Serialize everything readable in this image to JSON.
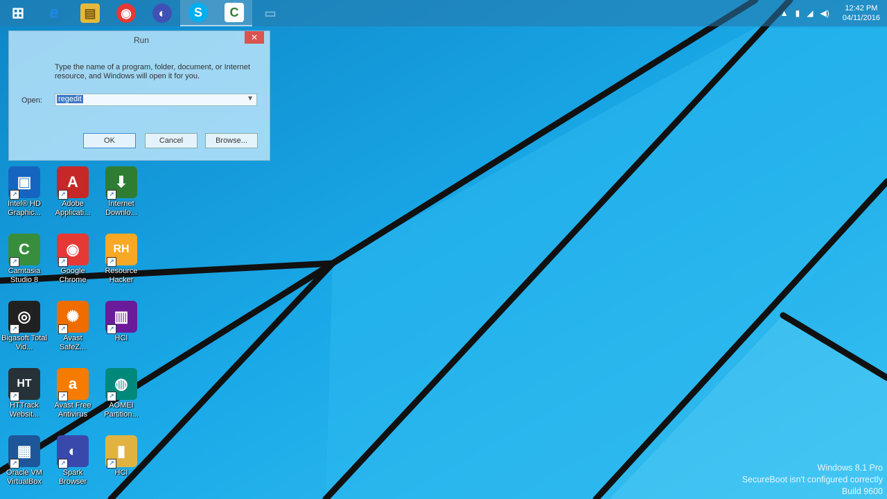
{
  "taskbar": {
    "apps": [
      {
        "name": "start-button",
        "glyph": "⊞",
        "color": "transparent"
      },
      {
        "name": "internet-explorer-icon",
        "glyph": "e",
        "color": "#1e88e5"
      },
      {
        "name": "file-explorer-icon",
        "glyph": "▤",
        "color": "#e6b93b"
      },
      {
        "name": "google-chrome-icon",
        "glyph": "◉",
        "color": "#e53935"
      },
      {
        "name": "spark-browser-icon",
        "glyph": "◐",
        "color": "#3f51b5"
      },
      {
        "name": "skype-icon",
        "glyph": "S",
        "color": "#00aff0"
      },
      {
        "name": "camtasia-icon",
        "glyph": "C",
        "color": "#2e7d32"
      },
      {
        "name": "window-icon",
        "glyph": "▭",
        "color": "transparent"
      }
    ],
    "clock_time": "12:42 PM",
    "clock_date": "04/11/2016"
  },
  "run_dialog": {
    "title": "Run",
    "description": "Type the name of a program, folder, document, or Internet resource, and Windows will open it for you.",
    "open_label": "Open:",
    "input_value": "regedit",
    "ok_label": "OK",
    "cancel_label": "Cancel",
    "browse_label": "Browse..."
  },
  "desktop_icons": [
    {
      "label": "Intel® HD Graphic...",
      "glyph": "▣",
      "color": "#1565c0"
    },
    {
      "label": "Adobe Applicati...",
      "glyph": "A",
      "color": "#c62828"
    },
    {
      "label": "Internet Downlo...",
      "glyph": "⬇",
      "color": "#2e7d32"
    },
    {
      "label": "Camtasia Studio 8",
      "glyph": "C",
      "color": "#388e3c"
    },
    {
      "label": "Google Chrome",
      "glyph": "◉",
      "color": "#e53935"
    },
    {
      "label": "Resource Hacker",
      "glyph": "RH",
      "color": "#f9a825"
    },
    {
      "label": "Bigasoft Total Vid...",
      "glyph": "◎",
      "color": "#212121"
    },
    {
      "label": "Avast SafeZ...",
      "glyph": "✺",
      "color": "#ef6c00"
    },
    {
      "label": "HCI",
      "glyph": "▥",
      "color": "#6a1b9a"
    },
    {
      "label": "HTTrack Websit...",
      "glyph": "HT",
      "color": "#263238"
    },
    {
      "label": "Avast Free Antivirus",
      "glyph": "a",
      "color": "#f57c00"
    },
    {
      "label": "AOMEI Partition...",
      "glyph": "◍",
      "color": "#00897b"
    },
    {
      "label": "Oracle VM VirtualBox",
      "glyph": "▦",
      "color": "#1e5799"
    },
    {
      "label": "Spark Browser",
      "glyph": "◐",
      "color": "#3949ab"
    },
    {
      "label": "HCI",
      "glyph": "▮",
      "color": "#e0b341"
    }
  ],
  "watermark": {
    "line1": "Windows 8.1 Pro",
    "line2": "SecureBoot isn't configured correctly",
    "line3": "Build 9600"
  }
}
